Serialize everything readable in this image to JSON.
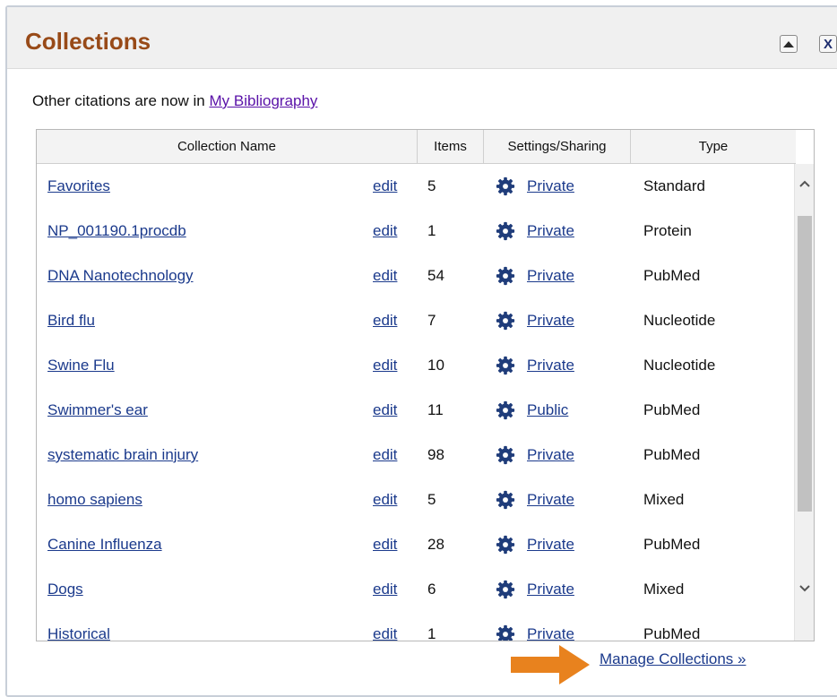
{
  "panel": {
    "title": "Collections",
    "collapse_icon": "triangle-up-icon",
    "close_label": "X"
  },
  "notice": {
    "text": "Other citations are now in ",
    "link": "My Bibliography"
  },
  "table": {
    "headers": {
      "name": "Collection Name",
      "items": "Items",
      "settings": "Settings/Sharing",
      "type": "Type"
    },
    "rows": [
      {
        "name": "Favorites",
        "edit": "edit",
        "items": "5",
        "sharing": "Private",
        "type": "Standard"
      },
      {
        "name": "NP_001190.1procdb",
        "edit": "edit",
        "items": "1",
        "sharing": "Private",
        "type": "Protein"
      },
      {
        "name": "DNA Nanotechnology",
        "edit": "edit",
        "items": "54",
        "sharing": "Private",
        "type": "PubMed"
      },
      {
        "name": "Bird flu",
        "edit": "edit",
        "items": "7",
        "sharing": "Private",
        "type": "Nucleotide"
      },
      {
        "name": "Swine Flu",
        "edit": "edit",
        "items": "10",
        "sharing": "Private",
        "type": "Nucleotide"
      },
      {
        "name": "Swimmer's ear",
        "edit": "edit",
        "items": "11",
        "sharing": "Public",
        "type": "PubMed"
      },
      {
        "name": "systematic brain injury",
        "edit": "edit",
        "items": "98",
        "sharing": "Private",
        "type": "PubMed"
      },
      {
        "name": "homo sapiens",
        "edit": "edit",
        "items": "5",
        "sharing": "Private",
        "type": "Mixed"
      },
      {
        "name": "Canine Influenza",
        "edit": "edit",
        "items": "28",
        "sharing": "Private",
        "type": "PubMed"
      },
      {
        "name": "Dogs",
        "edit": "edit",
        "items": "6",
        "sharing": "Private",
        "type": "Mixed"
      },
      {
        "name": "Historical",
        "edit": "edit",
        "items": "1",
        "sharing": "Private",
        "type": "PubMed"
      }
    ]
  },
  "footer": {
    "manage_link": "Manage Collections »",
    "pointer_icon": "orange-arrow-icon"
  },
  "colors": {
    "title": "#984a18",
    "link": "#1b3a8c",
    "visited_link": "#5a12a8",
    "arrow": "#e8821e",
    "gear": "#1f3c7a"
  }
}
